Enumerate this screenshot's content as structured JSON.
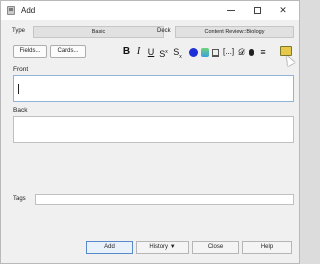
{
  "window": {
    "title": "Add"
  },
  "titlebar": {
    "minimize_icon": "minimize-icon",
    "maximize_icon": "maximize-icon",
    "close_glyph": "✕"
  },
  "header": {
    "type_label": "Type",
    "type_value": "Basic",
    "deck_label": "Deck",
    "deck_value": "Content Review::Biology"
  },
  "buttons": {
    "fields": "Fields...",
    "cards": "Cards..."
  },
  "toolbar": {
    "bold": "B",
    "italic": "I",
    "underline": "U",
    "superscript": "S",
    "superscript_mark": "x",
    "subscript": "S",
    "subscript_mark": "x",
    "cloze": "[...]",
    "attach": "𝒟",
    "menu": "≡",
    "text_color": "#1d2fd6"
  },
  "fields": {
    "front_label": "Front",
    "back_label": "Back"
  },
  "tags": {
    "label": "Tags"
  },
  "footer": {
    "add": "Add",
    "history": "History ▼",
    "close": "Close",
    "help": "Help"
  }
}
